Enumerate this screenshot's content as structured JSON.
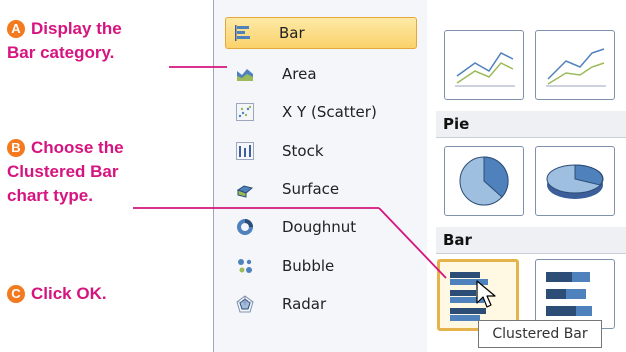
{
  "callouts": {
    "a": {
      "badge": "A",
      "line1": "Display the",
      "line2_em": "Bar",
      "line2_rest": " category."
    },
    "b": {
      "badge": "B",
      "line1": "Choose the",
      "line2_em": "Clustered Bar",
      "line3": "chart type."
    },
    "c": {
      "badge": "C",
      "text": "Click ",
      "em": "OK",
      "end": "."
    }
  },
  "categories": [
    {
      "label": "Bar",
      "icon": "bar-chart-icon",
      "selected": true
    },
    {
      "label": "Area",
      "icon": "area-chart-icon"
    },
    {
      "label": "X Y (Scatter)",
      "icon": "scatter-chart-icon"
    },
    {
      "label": "Stock",
      "icon": "stock-chart-icon"
    },
    {
      "label": "Surface",
      "icon": "surface-chart-icon"
    },
    {
      "label": "Doughnut",
      "icon": "doughnut-chart-icon"
    },
    {
      "label": "Bubble",
      "icon": "bubble-chart-icon"
    },
    {
      "label": "Radar",
      "icon": "radar-chart-icon"
    }
  ],
  "gallery": {
    "sections": [
      "Pie",
      "Bar"
    ],
    "tooltip": "Clustered Bar"
  },
  "colors": {
    "accent": "#d6147f",
    "badge": "#f47a20",
    "selection": "#fbd26b"
  }
}
